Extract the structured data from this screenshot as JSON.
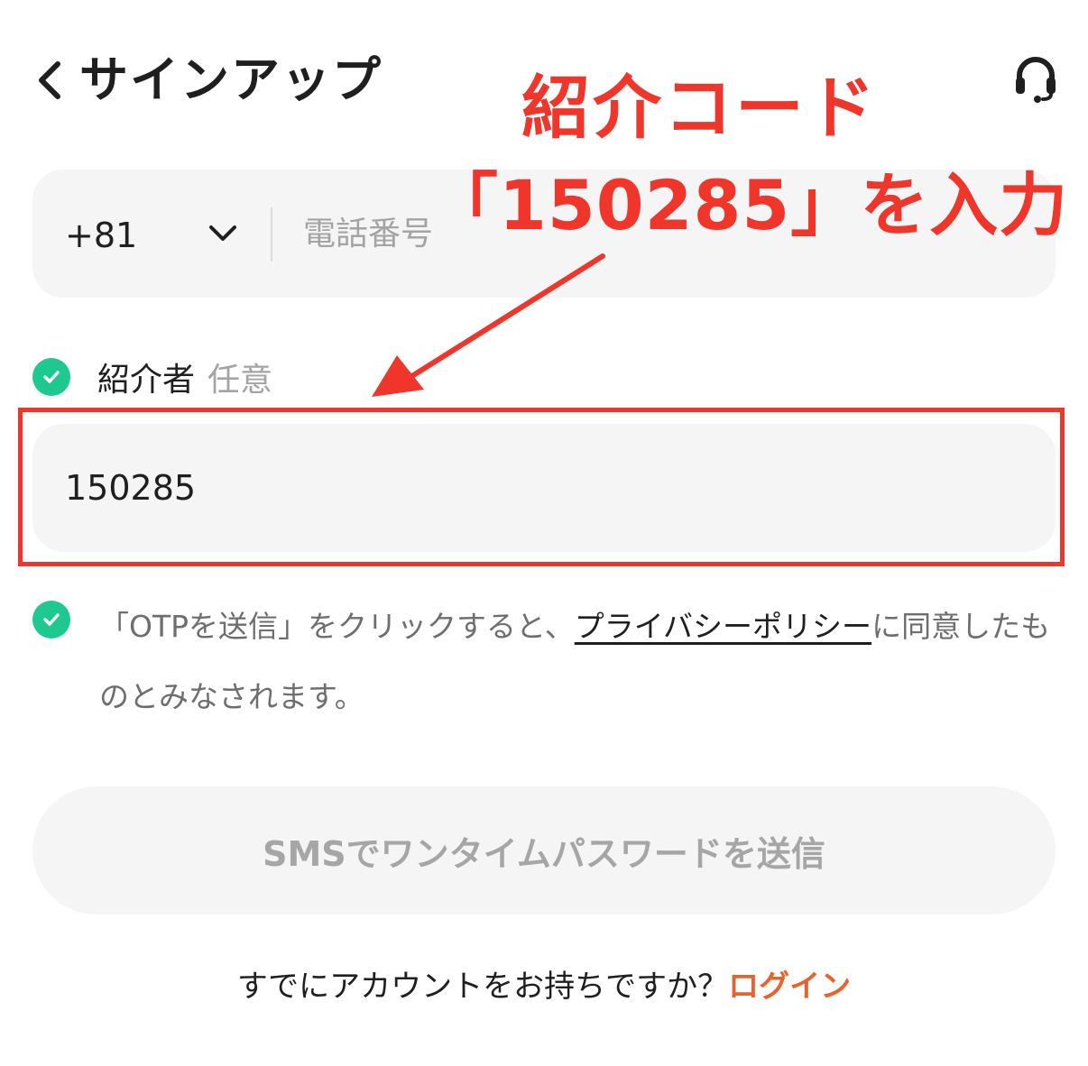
{
  "header": {
    "title": "サインアップ"
  },
  "phone": {
    "country_code": "+81",
    "placeholder": "電話番号",
    "value": ""
  },
  "referrer": {
    "label": "紹介者",
    "optional": "任意",
    "value": "150285"
  },
  "consent": {
    "text_before": "「OTPを送信」をクリックすると、",
    "link": "プライバシーポリシー",
    "text_after": "に同意したものとみなされます。"
  },
  "send_button": {
    "label": "SMSでワンタイムパスワードを送信"
  },
  "login": {
    "prompt": "すでにアカウントをお持ちですか？",
    "link": "ログイン"
  },
  "annotation": {
    "title": "紹介コード",
    "subtitle": "「150285」を入力"
  },
  "icons": {
    "back": "chevron-left-icon",
    "support": "headset-icon",
    "country": "chevron-down-icon",
    "check": "check-circle-icon"
  },
  "colors": {
    "accent_check": "#1ec98f",
    "annotation_red": "#f0352b",
    "login_link": "#e9622c",
    "field_background": "#f5f5f5"
  }
}
